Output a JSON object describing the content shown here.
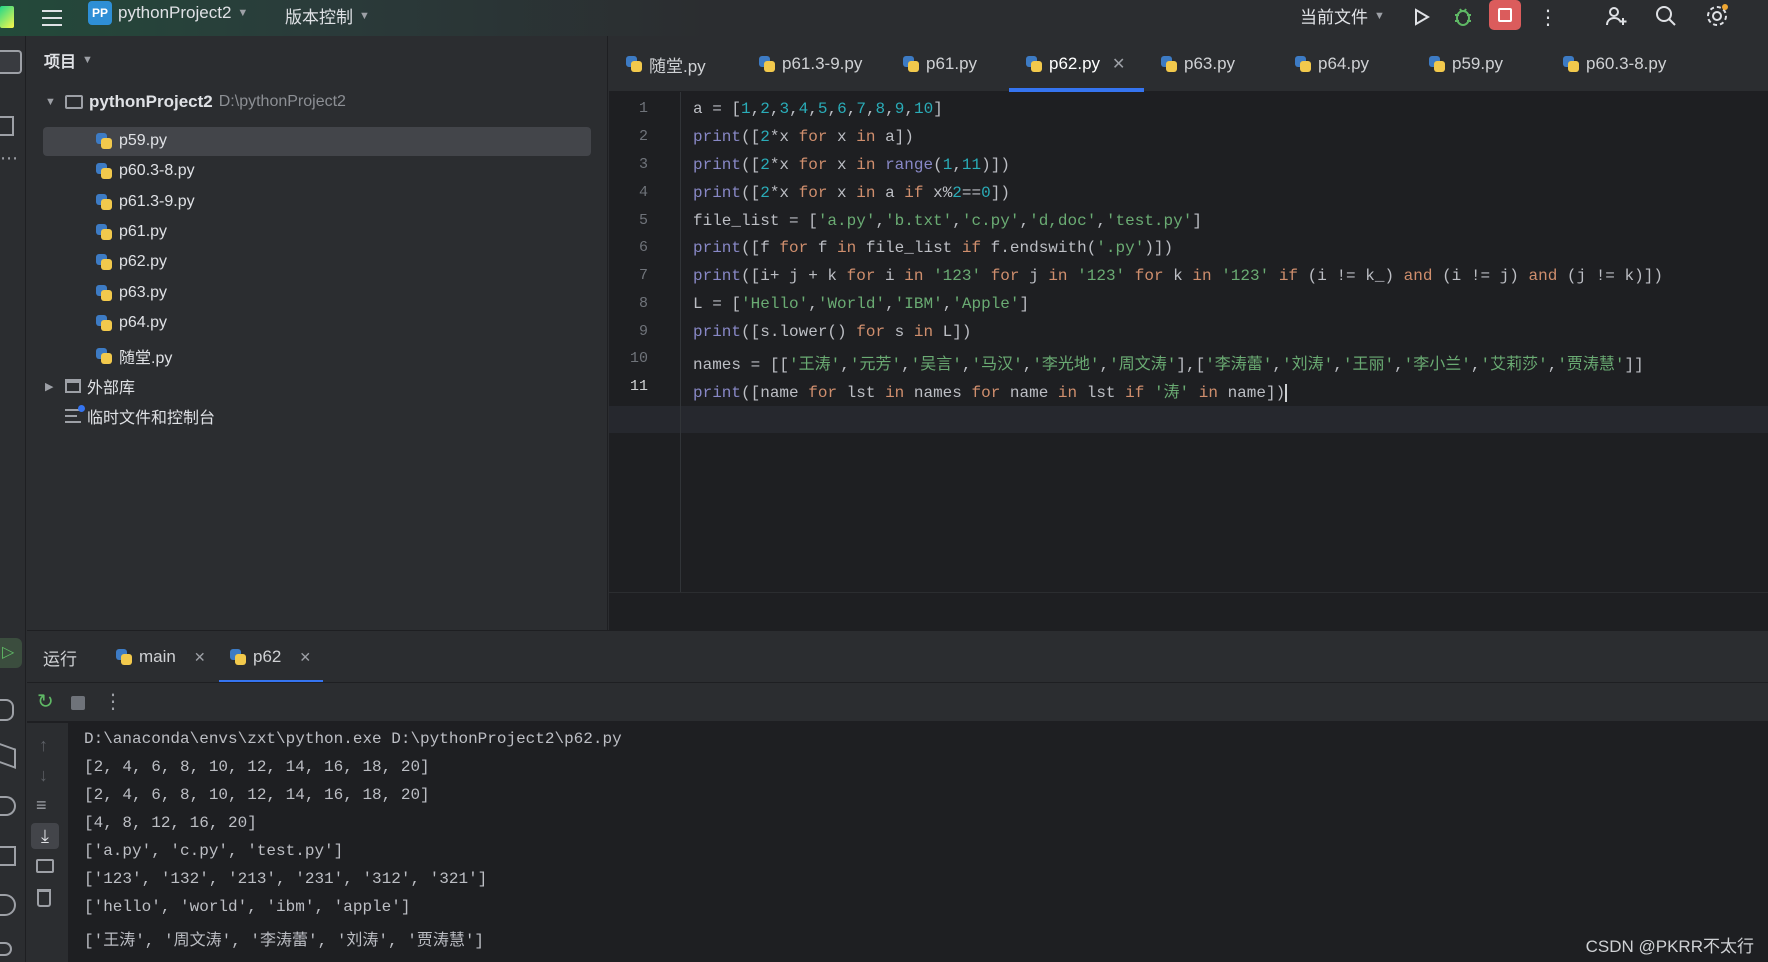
{
  "topbar": {
    "project_badge": "PP",
    "project_name": "pythonProject2",
    "vcs": "版本控制",
    "run_config": "当前文件"
  },
  "project_panel": {
    "title": "项目",
    "root_name": "pythonProject2",
    "root_path": "D:\\pythonProject2",
    "files": [
      "p59.py",
      "p60.3-8.py",
      "p61.3-9.py",
      "p61.py",
      "p62.py",
      "p63.py",
      "p64.py",
      "随堂.py"
    ],
    "external_libs": "外部库",
    "scratches": "临时文件和控制台"
  },
  "editor": {
    "tabs": [
      "随堂.py",
      "p61.3-9.py",
      "p61.py",
      "p62.py",
      "p63.py",
      "p64.py",
      "p59.py",
      "p60.3-8.py"
    ],
    "active_tab": "p62.py",
    "line_numbers": [
      "1",
      "2",
      "3",
      "4",
      "5",
      "6",
      "7",
      "8",
      "9",
      "10",
      "11"
    ]
  },
  "run": {
    "title": "运行",
    "tab_main": "main",
    "tab_p62": "p62",
    "output": [
      "D:\\anaconda\\envs\\zxt\\python.exe D:\\pythonProject2\\p62.py",
      "[2, 4, 6, 8, 10, 12, 14, 16, 18, 20]",
      "[2, 4, 6, 8, 10, 12, 14, 16, 18, 20]",
      "[4, 8, 12, 16, 20]",
      "['a.py', 'c.py', 'test.py']",
      "['123', '132', '213', '231', '312', '321']",
      "['hello', 'world', 'ibm', 'apple']",
      "['王涛', '周文涛', '李涛蕾', '刘涛', '贾涛慧']"
    ]
  },
  "watermark": "CSDN @PKRR不太行",
  "colors": {
    "accent": "#3574f0",
    "keyword": "#cf8e6d",
    "number": "#2aacb8",
    "string": "#6aab73",
    "builtin": "#8888c6"
  }
}
